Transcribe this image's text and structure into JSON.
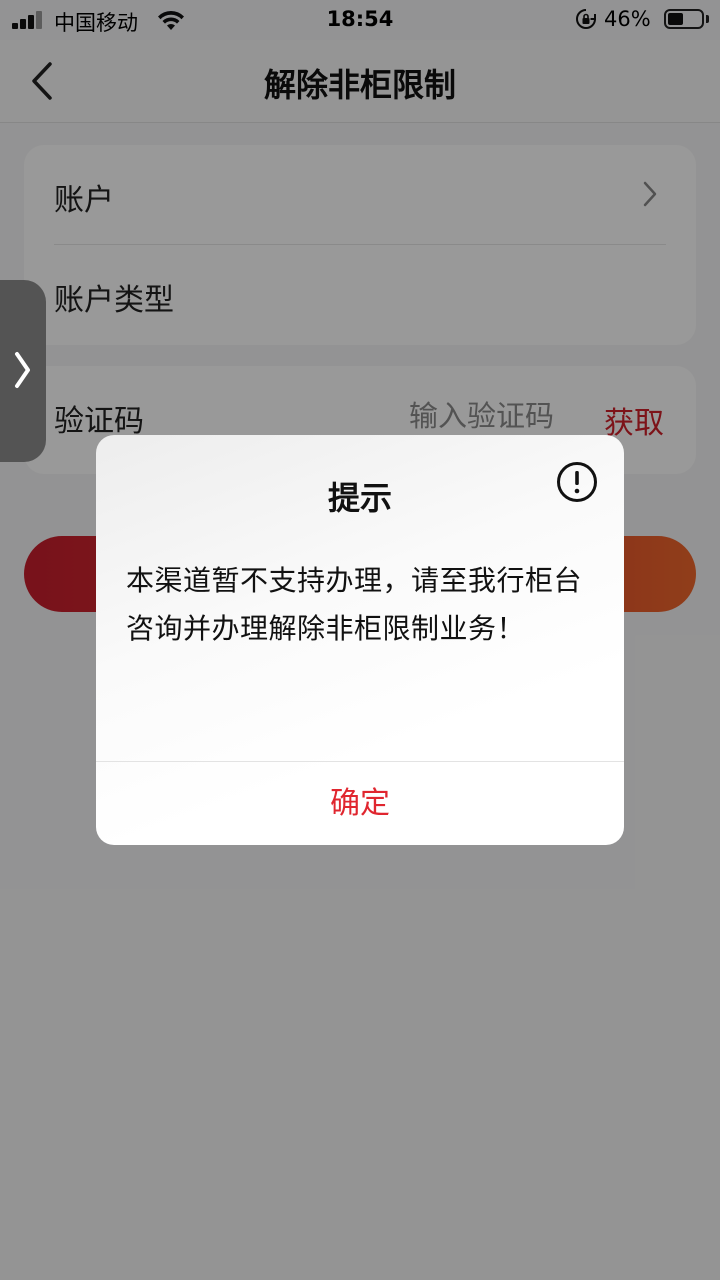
{
  "status_bar": {
    "carrier": "中国移动",
    "time": "18:54",
    "battery_percent": "46%",
    "battery_level": 0.46,
    "icons": [
      "signal-icon",
      "wifi-icon",
      "rotation-lock-icon",
      "battery-icon"
    ]
  },
  "nav": {
    "title": "解除非柜限制",
    "back_icon": "back-chevron-icon"
  },
  "form": {
    "account_label": "账户",
    "account_type_label": "账户类型",
    "code_label": "验证码",
    "code_value": "",
    "code_placeholder": "输入验证码",
    "get_code_label": "获取",
    "accent_color": "#d0202a"
  },
  "dialog": {
    "title": "提示",
    "message": "本渠道暂不支持办理，请至我行柜台咨询并办理解除非柜限制业务！",
    "ok_label": "确定",
    "icon": "info-exclamation-icon",
    "ok_color": "#e0262f"
  }
}
